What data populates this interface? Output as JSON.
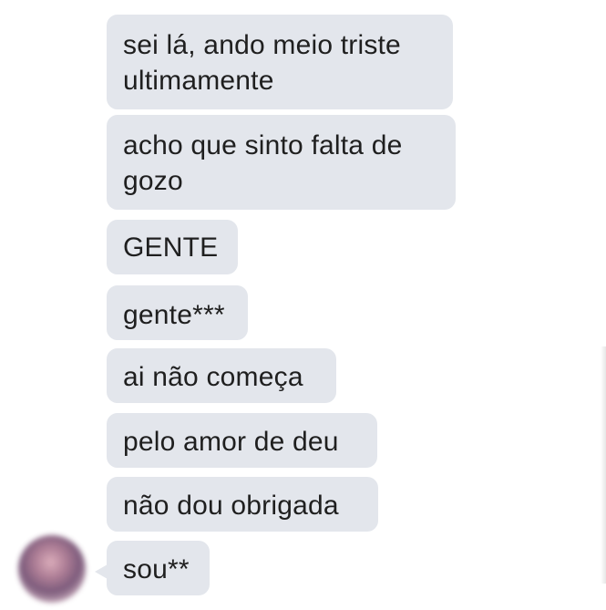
{
  "messages": [
    {
      "text": "sei lá, ando meio triste\nultimamente"
    },
    {
      "text": "acho que sinto falta de\ngozo"
    },
    {
      "text": "GENTE"
    },
    {
      "text": "gente***"
    },
    {
      "text": "ai não começa"
    },
    {
      "text": "pelo amor de deu"
    },
    {
      "text": "não dou obrigada"
    },
    {
      "text": "sou**"
    }
  ],
  "colors": {
    "bubble_background": "#e3e6ec",
    "bubble_text": "#1f1f1f",
    "page_background": "#ffffff"
  }
}
